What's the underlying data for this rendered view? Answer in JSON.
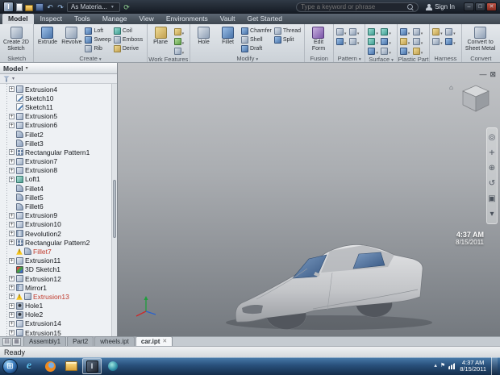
{
  "titlebar": {
    "material_dropdown": "As Materia...",
    "search_placeholder": "Type a keyword or phrase",
    "sign_in_label": "Sign In"
  },
  "ribbon": {
    "tabs": [
      {
        "label": "Model",
        "active": true
      },
      {
        "label": "Inspect"
      },
      {
        "label": "Tools"
      },
      {
        "label": "Manage"
      },
      {
        "label": "View"
      },
      {
        "label": "Environments"
      },
      {
        "label": "Vault"
      },
      {
        "label": "Get Started"
      }
    ],
    "panels": {
      "sketch": {
        "label": "Sketch",
        "create_2d_sketch": "Create 2D Sketch"
      },
      "create": {
        "label": "Create",
        "extrude": "Extrude",
        "revolve": "Revolve",
        "loft": "Loft",
        "sweep": "Sweep",
        "rib": "Rib",
        "coil": "Coil",
        "emboss": "Emboss",
        "derive": "Derive"
      },
      "work_features": {
        "label": "Work Features",
        "plane": "Plane",
        "icons": [
          {
            "name": "work-axis-icon",
            "icon": "gold"
          },
          {
            "name": "work-point-icon",
            "icon": "green"
          },
          {
            "name": "work-ucs-icon",
            "icon": "steel"
          }
        ]
      },
      "modify": {
        "label": "Modify",
        "hole": "Hole",
        "fillet": "Fillet",
        "chamfer": "Chamfer",
        "shell": "Shell",
        "draft": "Draft",
        "thread": "Thread",
        "split": "Split"
      },
      "fusion": {
        "label": "Fusion",
        "edit_form": "Edit Form"
      },
      "pattern": {
        "label": "Pattern",
        "icons": [
          {
            "name": "rectangular-pattern-icon",
            "icon": "steel"
          },
          {
            "name": "circular-pattern-icon",
            "icon": "steel"
          },
          {
            "name": "mirror-icon",
            "icon": "blue"
          },
          {
            "name": "sketch-driven-pattern-icon",
            "icon": "steel"
          }
        ]
      },
      "surface": {
        "label": "Surface",
        "icons": [
          {
            "name": "stitch-icon",
            "icon": "teal"
          },
          {
            "name": "sculpt-icon",
            "icon": "teal"
          },
          {
            "name": "patch-icon",
            "icon": "teal"
          },
          {
            "name": "trim-icon",
            "icon": "blue"
          },
          {
            "name": "extend-icon",
            "icon": "blue"
          },
          {
            "name": "delete-face-icon",
            "icon": "steel"
          }
        ]
      },
      "plastic_part": {
        "label": "Plastic Part",
        "icons": [
          {
            "name": "grille-icon",
            "icon": "blue"
          },
          {
            "name": "boss-icon",
            "icon": "steel"
          },
          {
            "name": "rest-icon",
            "icon": "gold"
          },
          {
            "name": "snap-fit-icon",
            "icon": "steel"
          },
          {
            "name": "rule-fillet-icon",
            "icon": "blue"
          },
          {
            "name": "lip-icon",
            "icon": "gold"
          }
        ]
      },
      "harness": {
        "label": "Harness",
        "icons": [
          {
            "name": "create-harness-icon",
            "icon": "gold"
          },
          {
            "name": "route-icon",
            "icon": "steel"
          },
          {
            "name": "segment-icon",
            "icon": "steel"
          },
          {
            "name": "connector-icon",
            "icon": "blue"
          }
        ]
      },
      "convert": {
        "label": "Convert",
        "convert_to_sheet_metal": "Convert to Sheet Metal"
      }
    }
  },
  "browser": {
    "title": "Model",
    "tree": [
      {
        "label": "Extrusion4",
        "icon": "extrusion",
        "plus": true
      },
      {
        "label": "Sketch10",
        "icon": "sketch"
      },
      {
        "label": "Sketch11",
        "icon": "sketch"
      },
      {
        "label": "Extrusion5",
        "icon": "extrusion",
        "plus": true
      },
      {
        "label": "Extrusion6",
        "icon": "extrusion",
        "plus": true
      },
      {
        "label": "Fillet2",
        "icon": "fillet"
      },
      {
        "label": "Fillet3",
        "icon": "fillet"
      },
      {
        "label": "Rectangular Pattern1",
        "icon": "pattern",
        "plus": true
      },
      {
        "label": "Extrusion7",
        "icon": "extrusion",
        "plus": true
      },
      {
        "label": "Extrusion8",
        "icon": "extrusion",
        "plus": true
      },
      {
        "label": "Loft1",
        "icon": "loft",
        "plus": true
      },
      {
        "label": "Fillet4",
        "icon": "fillet"
      },
      {
        "label": "Fillet5",
        "icon": "fillet"
      },
      {
        "label": "Fillet6",
        "icon": "fillet"
      },
      {
        "label": "Extrusion9",
        "icon": "extrusion",
        "plus": true
      },
      {
        "label": "Extrusion10",
        "icon": "extrusion",
        "plus": true
      },
      {
        "label": "Revolution2",
        "icon": "revolution",
        "plus": true
      },
      {
        "label": "Rectangular Pattern2",
        "icon": "pattern",
        "plus": true
      },
      {
        "label": "Fillet7",
        "icon": "fillet",
        "warn": true,
        "error": true
      },
      {
        "label": "Extrusion11",
        "icon": "extrusion",
        "plus": true
      },
      {
        "label": "3D Sketch1",
        "icon": "sketch3d"
      },
      {
        "label": "Extrusion12",
        "icon": "extrusion",
        "plus": true
      },
      {
        "label": "Mirror1",
        "icon": "mirror",
        "plus": true
      },
      {
        "label": "Extrusion13",
        "icon": "extrusion",
        "plus": true,
        "warn": true,
        "error": true
      },
      {
        "label": "Hole1",
        "icon": "hole",
        "plus": true
      },
      {
        "label": "Hole2",
        "icon": "hole",
        "plus": true
      },
      {
        "label": "Extrusion14",
        "icon": "extrusion",
        "plus": true
      },
      {
        "label": "Extrusion15",
        "icon": "extrusion",
        "plus": true
      }
    ]
  },
  "viewport": {
    "clock_time": "4:37 AM",
    "clock_date": "8/15/2011",
    "nav_icons": [
      {
        "name": "navigation-wheel-icon",
        "glyph": "◎"
      },
      {
        "name": "pan-icon",
        "glyph": "+"
      },
      {
        "name": "zoom-icon",
        "glyph": "⊕"
      },
      {
        "name": "orbit-icon",
        "glyph": "↺"
      },
      {
        "name": "look-at-icon",
        "glyph": "▣"
      },
      {
        "name": "more-tools-icon",
        "glyph": "▾"
      }
    ]
  },
  "doc_tabs": [
    {
      "label": "Assembly1"
    },
    {
      "label": "Part2"
    },
    {
      "label": "wheels.ipt"
    },
    {
      "label": "car.ipt",
      "active": true
    }
  ],
  "statusbar": {
    "message": "Ready"
  },
  "taskbar": {
    "apps": [
      {
        "name": "internet-explorer-icon",
        "icon": "ie"
      },
      {
        "name": "firefox-icon",
        "icon": "firefox"
      },
      {
        "name": "windows-explorer-icon",
        "icon": "explorer"
      },
      {
        "name": "inventor-icon",
        "icon": "inventor",
        "active": true
      },
      {
        "name": "media-player-icon",
        "icon": "media"
      }
    ],
    "clock_time": "4:37 AM",
    "clock_date": "8/15/2011"
  }
}
